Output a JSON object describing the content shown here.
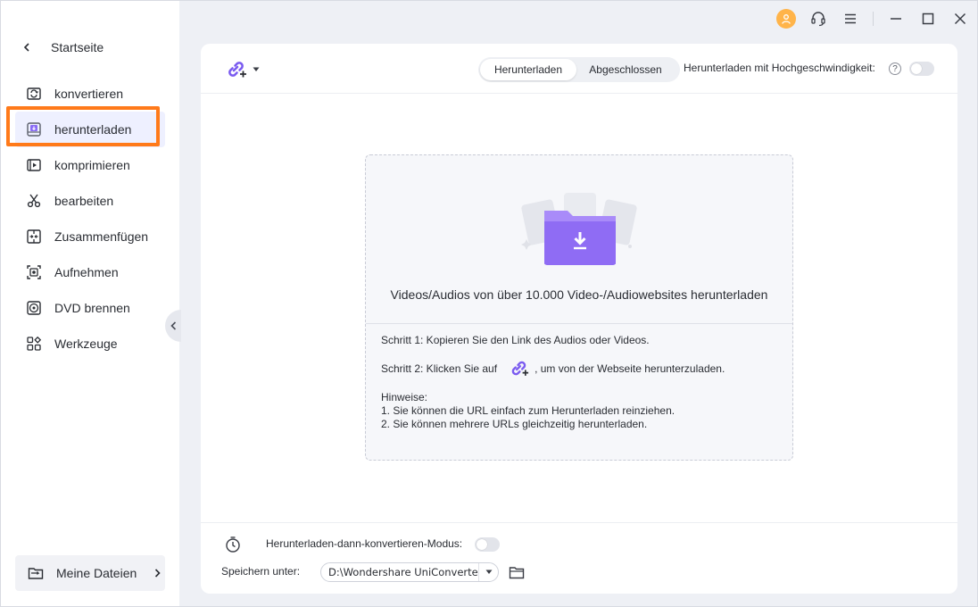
{
  "sidebar": {
    "back_label": "Startseite",
    "items": [
      {
        "label": "konvertieren",
        "icon": "convert-icon"
      },
      {
        "label": "herunterladen",
        "icon": "download-icon",
        "active": true
      },
      {
        "label": "komprimieren",
        "icon": "compress-icon"
      },
      {
        "label": "bearbeiten",
        "icon": "scissors-icon"
      },
      {
        "label": "Zusammenfügen",
        "icon": "merge-icon"
      },
      {
        "label": "Aufnehmen",
        "icon": "record-icon"
      },
      {
        "label": "DVD brennen",
        "icon": "dvd-icon"
      },
      {
        "label": "Werkzeuge",
        "icon": "toolbox-icon"
      }
    ],
    "files_label": "Meine Dateien"
  },
  "titlebar": {
    "icons": [
      "user-avatar-icon",
      "headset-icon",
      "menu-icon",
      "minimize-icon",
      "maximize-icon",
      "close-icon"
    ]
  },
  "toolbar": {
    "tabs": [
      {
        "label": "Herunterladen",
        "active": true
      },
      {
        "label": "Abgeschlossen",
        "active": false
      }
    ],
    "highspeed_label": "Herunterladen mit Hochgeschwindigkeit:",
    "highspeed_on": false,
    "help_glyph": "?"
  },
  "dropzone": {
    "title": "Videos/Audios von über 10.000 Video-/Audiowebsites herunterladen",
    "step1": "Schritt 1: Kopieren Sie den Link des Audios oder Videos.",
    "step2_before": "Schritt 2: Klicken Sie auf",
    "step2_after": ", um von der Webseite herunterzuladen.",
    "hints_title": "Hinweise:",
    "hint1": "1. Sie können die URL einfach zum Herunterladen reinziehen.",
    "hint2": "2. Sie können mehrere URLs gleichzeitig herunterladen."
  },
  "bottom": {
    "mode_label": "Herunterladen-dann-konvertieren-Modus:",
    "mode_on": false,
    "save_label": "Speichern unter:",
    "save_path": "D:\\Wondershare UniConverter"
  },
  "colors": {
    "accent": "#7b5cf0",
    "highlight": "#ff7a1a",
    "avatar": "#ffb44a"
  }
}
